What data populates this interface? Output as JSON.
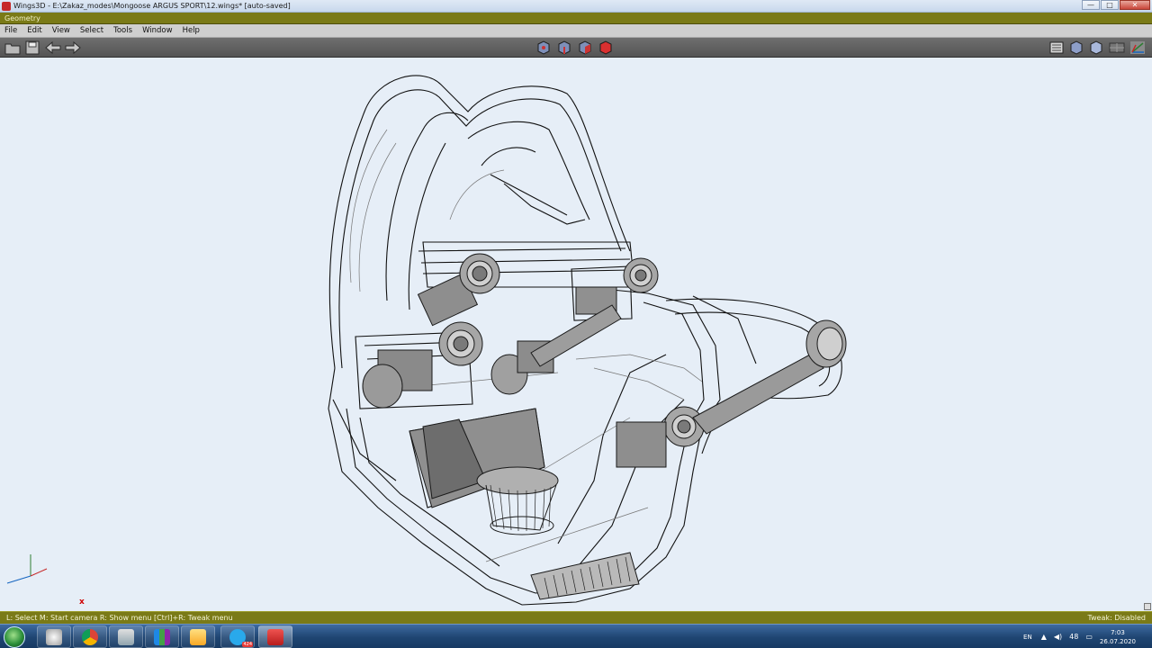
{
  "window": {
    "title": "Wings3D - E:\\Zakaz_modes\\Mongoose ARGUS SPORT\\12.wings* [auto-saved]",
    "controls": {
      "minimize": "—",
      "maximize": "□",
      "close": "✕"
    }
  },
  "geometry_label": "Geometry",
  "menu": {
    "items": [
      {
        "label": "File"
      },
      {
        "label": "Edit"
      },
      {
        "label": "View"
      },
      {
        "label": "Select"
      },
      {
        "label": "Tools"
      },
      {
        "label": "Window"
      },
      {
        "label": "Help"
      }
    ]
  },
  "toolbar": {
    "left": [
      "open-folder-icon",
      "save-icon",
      "undo-arrow-icon",
      "redo-arrow-icon"
    ],
    "selection_modes": [
      "vertex-mode-icon",
      "edge-mode-icon",
      "face-mode-icon",
      "body-mode-icon"
    ],
    "right": [
      "groups-icon",
      "smooth-shade-icon",
      "flat-shade-icon",
      "wireframe-icon",
      "axes-icon"
    ]
  },
  "viewport": {
    "origin_marker": "x",
    "background": "#e6eef7"
  },
  "statusbar": {
    "hints": "L: Select   M: Start camera   R: Show menu   [Ctrl]+R: Tweak menu",
    "tweak": "Tweak: Disabled"
  },
  "taskbar": {
    "apps": [
      "start-orb",
      "search-icon",
      "chrome-icon",
      "calculator-icon",
      "app-icon",
      "explorer-icon",
      "telegram-icon",
      "wings3d-icon"
    ],
    "telegram_badge": "424",
    "language": "EN",
    "tray_count": "48",
    "time": "7:03",
    "date": "26.07.2020"
  }
}
